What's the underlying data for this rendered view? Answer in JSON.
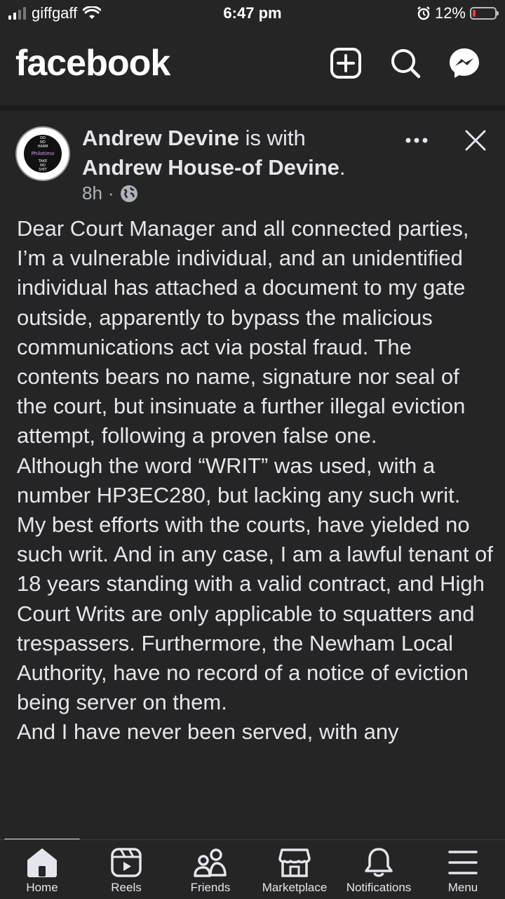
{
  "status_bar": {
    "carrier": "giffgaff",
    "time": "6:47 pm",
    "battery": "12%",
    "battery_level": 0.12
  },
  "header": {
    "app_name": "facebook"
  },
  "post": {
    "author": "Andrew Devine",
    "connector": "is with",
    "tagged": "Andrew House-of Devine",
    "time": "8h",
    "avatar_text": [
      "DO",
      "NO",
      "HARM",
      "Philotimo",
      "TAKE",
      "NO",
      "SHIT"
    ],
    "paragraphs": [
      "Dear Court Manager and all connected parties,",
      "I’m a vulnerable individual, and an unidentified individual has attached a document to my gate outside, apparently to bypass the malicious communications act via postal fraud.  The contents bears no name, signature nor seal of the court, but insinuate a further illegal eviction attempt, following a proven false one.",
      "Although the word “WRIT” was used, with a number HP3EC280, but lacking any such writ. My best efforts with the courts, have yielded no such writ. And in any case, I am a lawful tenant of 18 years standing with a valid contract, and High Court Writs are only applicable to squatters and trespassers. Furthermore, the Newham Local Authority, have no record of a notice of eviction being server on them.",
      "And I have never been served, with any"
    ]
  },
  "tabs": [
    {
      "label": "Home",
      "icon": "home-icon"
    },
    {
      "label": "Reels",
      "icon": "reels-icon"
    },
    {
      "label": "Friends",
      "icon": "friends-icon"
    },
    {
      "label": "Marketplace",
      "icon": "marketplace-icon"
    },
    {
      "label": "Notifications",
      "icon": "bell-icon"
    },
    {
      "label": "Menu",
      "icon": "menu-icon"
    }
  ]
}
